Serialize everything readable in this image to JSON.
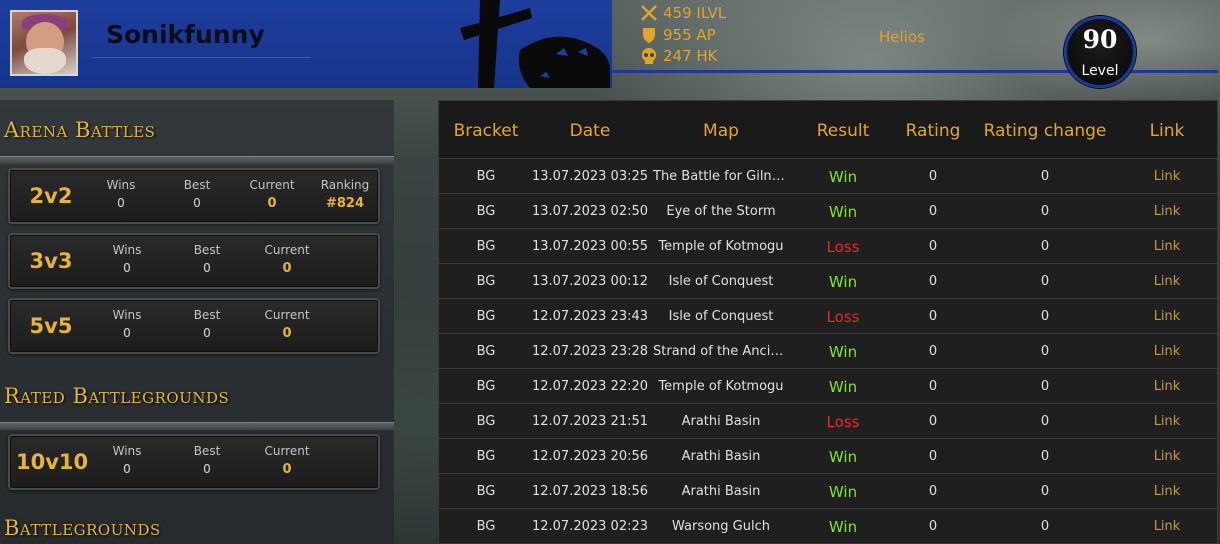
{
  "character": {
    "name": "Sonikfunny",
    "realm": "Helios",
    "level": "90",
    "level_label": "Level",
    "stats": [
      {
        "icon": "crossed-swords-icon",
        "text": "459 ILVL"
      },
      {
        "icon": "shield-icon",
        "text": "955 AP"
      },
      {
        "icon": "skull-icon",
        "text": "247 HK"
      }
    ]
  },
  "sections": {
    "arena_title": "Arena Battles",
    "rated_bg_title": "Rated Battlegrounds",
    "bg_title": "Battlegrounds"
  },
  "arena": [
    {
      "bracket": "2v2",
      "labels": [
        "Wins",
        "Best",
        "Current",
        "Ranking"
      ],
      "values": [
        "0",
        "0",
        "0",
        "#824"
      ]
    },
    {
      "bracket": "3v3",
      "labels": [
        "Wins",
        "Best",
        "Current"
      ],
      "values": [
        "0",
        "0",
        "0"
      ]
    },
    {
      "bracket": "5v5",
      "labels": [
        "Wins",
        "Best",
        "Current"
      ],
      "values": [
        "0",
        "0",
        "0"
      ]
    }
  ],
  "rated_bg": [
    {
      "bracket": "10v10",
      "labels": [
        "Wins",
        "Best",
        "Current"
      ],
      "values": [
        "0",
        "0",
        "0"
      ]
    }
  ],
  "table": {
    "headers": [
      "Bracket",
      "Date",
      "Map",
      "Result",
      "Rating",
      "Rating change",
      "Link"
    ],
    "rows": [
      {
        "bracket": "BG",
        "date": "13.07.2023 03:25",
        "map": "The Battle for Gilneas",
        "result": "Win",
        "rating": "0",
        "change": "0",
        "link": "Link"
      },
      {
        "bracket": "BG",
        "date": "13.07.2023 02:50",
        "map": "Eye of the Storm",
        "result": "Win",
        "rating": "0",
        "change": "0",
        "link": "Link"
      },
      {
        "bracket": "BG",
        "date": "13.07.2023 00:55",
        "map": "Temple of Kotmogu",
        "result": "Loss",
        "rating": "0",
        "change": "0",
        "link": "Link"
      },
      {
        "bracket": "BG",
        "date": "13.07.2023 00:12",
        "map": "Isle of Conquest",
        "result": "Win",
        "rating": "0",
        "change": "0",
        "link": "Link"
      },
      {
        "bracket": "BG",
        "date": "12.07.2023 23:43",
        "map": "Isle of Conquest",
        "result": "Loss",
        "rating": "0",
        "change": "0",
        "link": "Link"
      },
      {
        "bracket": "BG",
        "date": "12.07.2023 23:28",
        "map": "Strand of the Ancients",
        "result": "Win",
        "rating": "0",
        "change": "0",
        "link": "Link"
      },
      {
        "bracket": "BG",
        "date": "12.07.2023 22:20",
        "map": "Temple of Kotmogu",
        "result": "Win",
        "rating": "0",
        "change": "0",
        "link": "Link"
      },
      {
        "bracket": "BG",
        "date": "12.07.2023 21:51",
        "map": "Arathi Basin",
        "result": "Loss",
        "rating": "0",
        "change": "0",
        "link": "Link"
      },
      {
        "bracket": "BG",
        "date": "12.07.2023 20:56",
        "map": "Arathi Basin",
        "result": "Win",
        "rating": "0",
        "change": "0",
        "link": "Link"
      },
      {
        "bracket": "BG",
        "date": "12.07.2023 18:56",
        "map": "Arathi Basin",
        "result": "Win",
        "rating": "0",
        "change": "0",
        "link": "Link"
      },
      {
        "bracket": "BG",
        "date": "12.07.2023 02:23",
        "map": "Warsong Gulch",
        "result": "Win",
        "rating": "0",
        "change": "0",
        "link": "Link"
      }
    ]
  },
  "colors": {
    "gold": "#e6b43c",
    "win": "#7fe52a",
    "loss": "#e52a2a",
    "header_blue": "#1e3e9e"
  }
}
